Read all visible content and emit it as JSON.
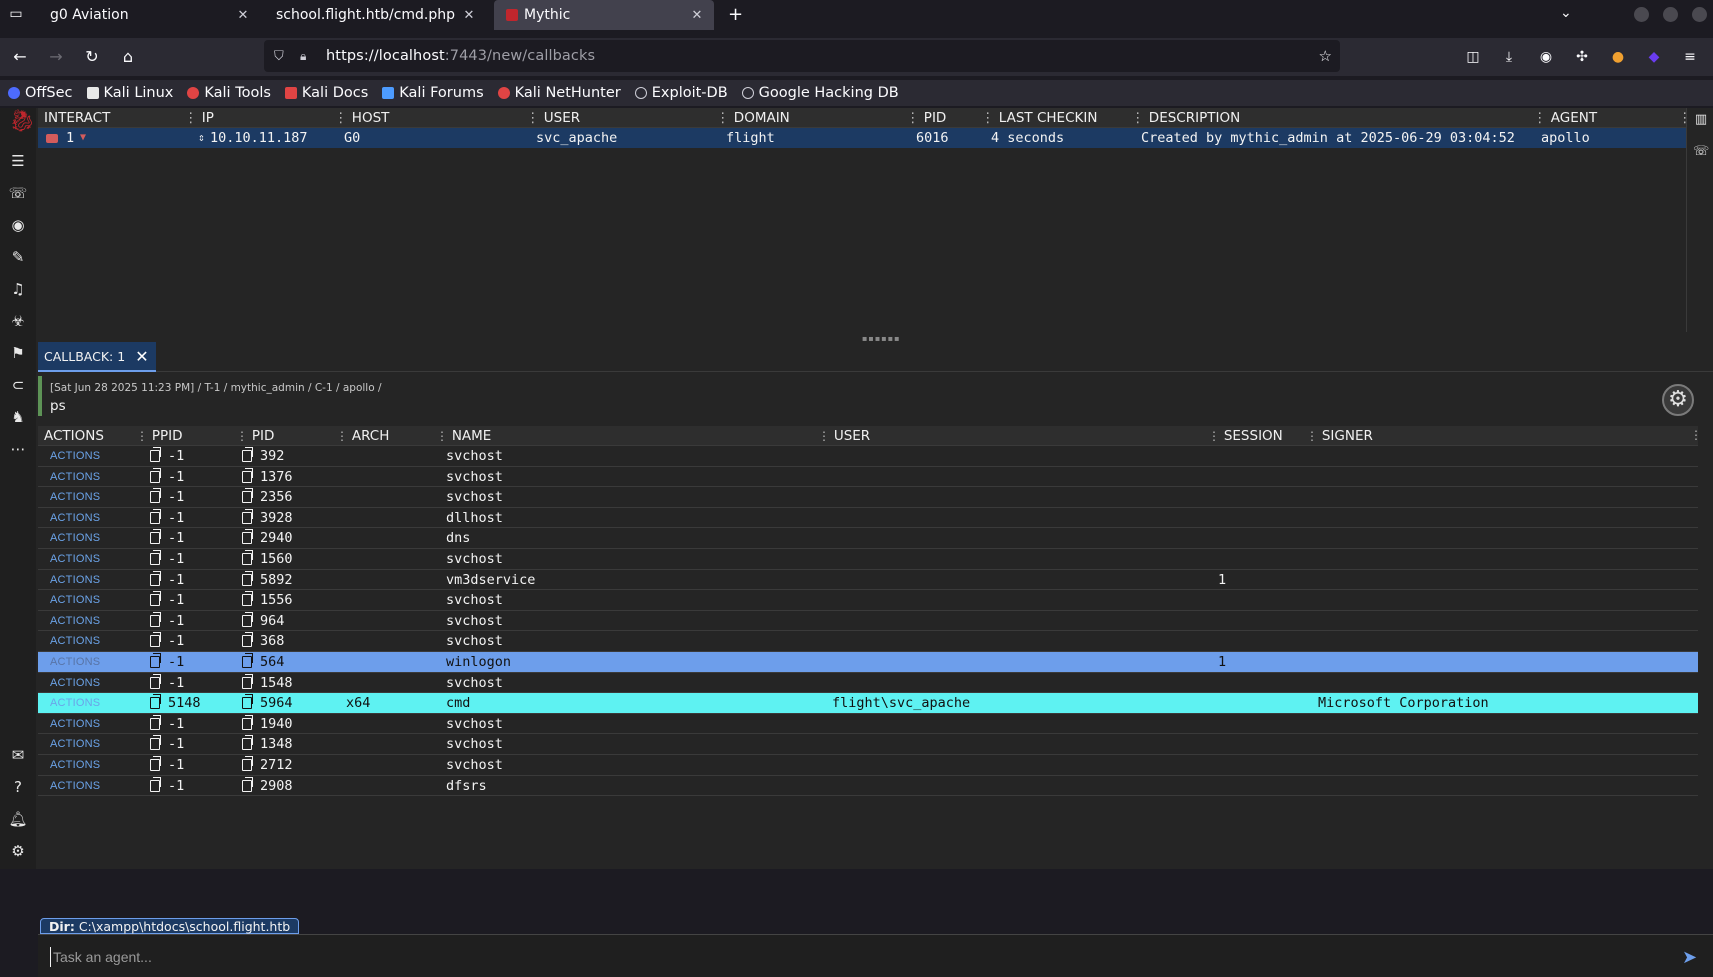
{
  "browser": {
    "tabs": [
      {
        "title": "g0 Aviation",
        "active": false
      },
      {
        "title": "school.flight.htb/cmd.php?cmd",
        "active": false
      },
      {
        "title": "Mythic",
        "active": true
      }
    ],
    "url_host": "https://localhost",
    "url_rest": ":7443/new/callbacks",
    "bookmarks": [
      {
        "label": "OffSec",
        "color": "#4d6bfe"
      },
      {
        "label": "Kali Linux",
        "color": "#e8e8e8"
      },
      {
        "label": "Kali Tools",
        "color": "#e04444"
      },
      {
        "label": "Kali Docs",
        "color": "#e04444"
      },
      {
        "label": "Kali Forums",
        "color": "#4d9bfe"
      },
      {
        "label": "Kali NetHunter",
        "color": "#e04444"
      },
      {
        "label": "Exploit-DB",
        "color": "#cfcfd8"
      },
      {
        "label": "Google Hacking DB",
        "color": "#cfcfd8"
      }
    ]
  },
  "callbacks": {
    "columns": [
      "INTERACT",
      "IP",
      "HOST",
      "USER",
      "DOMAIN",
      "PID",
      "LAST CHECKIN",
      "DESCRIPTION",
      "AGENT"
    ],
    "row": {
      "id": "1",
      "ip": "10.10.11.187",
      "host": "G0",
      "user": "svc_apache",
      "domain": "flight",
      "pid": "6016",
      "last_checkin": "4 seconds",
      "description": "Created by mythic_admin at 2025-06-29 03:04:52",
      "agent": "apollo"
    }
  },
  "callback_tab": {
    "label": "CALLBACK: 1"
  },
  "task": {
    "meta": "[Sat Jun 28 2025 11:23 PM] / T-1 / mythic_admin / C-1 / apollo /",
    "command": "ps"
  },
  "process_grid": {
    "columns": [
      "ACTIONS",
      "PPID",
      "PID",
      "ARCH",
      "NAME",
      "USER",
      "SESSION",
      "SIGNER"
    ],
    "action_label": "ACTIONS",
    "rows": [
      {
        "ppid": "-1",
        "pid": "392",
        "arch": "",
        "name": "svchost",
        "user": "",
        "session": "",
        "signer": ""
      },
      {
        "ppid": "-1",
        "pid": "1376",
        "arch": "",
        "name": "svchost",
        "user": "",
        "session": "",
        "signer": ""
      },
      {
        "ppid": "-1",
        "pid": "2356",
        "arch": "",
        "name": "svchost",
        "user": "",
        "session": "",
        "signer": ""
      },
      {
        "ppid": "-1",
        "pid": "3928",
        "arch": "",
        "name": "dllhost",
        "user": "",
        "session": "",
        "signer": ""
      },
      {
        "ppid": "-1",
        "pid": "2940",
        "arch": "",
        "name": "dns",
        "user": "",
        "session": "",
        "signer": ""
      },
      {
        "ppid": "-1",
        "pid": "1560",
        "arch": "",
        "name": "svchost",
        "user": "",
        "session": "",
        "signer": ""
      },
      {
        "ppid": "-1",
        "pid": "5892",
        "arch": "",
        "name": "vm3dservice",
        "user": "",
        "session": "1",
        "signer": ""
      },
      {
        "ppid": "-1",
        "pid": "1556",
        "arch": "",
        "name": "svchost",
        "user": "",
        "session": "",
        "signer": ""
      },
      {
        "ppid": "-1",
        "pid": "964",
        "arch": "",
        "name": "svchost",
        "user": "",
        "session": "",
        "signer": ""
      },
      {
        "ppid": "-1",
        "pid": "368",
        "arch": "",
        "name": "svchost",
        "user": "",
        "session": "",
        "signer": ""
      },
      {
        "ppid": "-1",
        "pid": "564",
        "arch": "",
        "name": "winlogon",
        "user": "",
        "session": "1",
        "signer": "",
        "state": "sel"
      },
      {
        "ppid": "-1",
        "pid": "1548",
        "arch": "",
        "name": "svchost",
        "user": "",
        "session": "",
        "signer": ""
      },
      {
        "ppid": "5148",
        "pid": "5964",
        "arch": "x64",
        "name": "cmd",
        "user": "flight\\svc_apache",
        "session": "",
        "signer": "Microsoft Corporation",
        "state": "hl"
      },
      {
        "ppid": "-1",
        "pid": "1940",
        "arch": "",
        "name": "svchost",
        "user": "",
        "session": "",
        "signer": ""
      },
      {
        "ppid": "-1",
        "pid": "1348",
        "arch": "",
        "name": "svchost",
        "user": "",
        "session": "",
        "signer": ""
      },
      {
        "ppid": "-1",
        "pid": "2712",
        "arch": "",
        "name": "svchost",
        "user": "",
        "session": "",
        "signer": ""
      },
      {
        "ppid": "-1",
        "pid": "2908",
        "arch": "",
        "name": "dfsrs",
        "user": "",
        "session": "",
        "signer": ""
      }
    ]
  },
  "footer": {
    "dir_label": "Dir:",
    "dir_value": "C:\\xampp\\htdocs\\school.flight.htb",
    "task_placeholder": "Task an agent..."
  },
  "colors": {
    "selected_row": "#6d9eeb",
    "highlight_row": "#5ef2f2",
    "callback_row": "#1c3a63",
    "accent": "#6d9eeb"
  }
}
